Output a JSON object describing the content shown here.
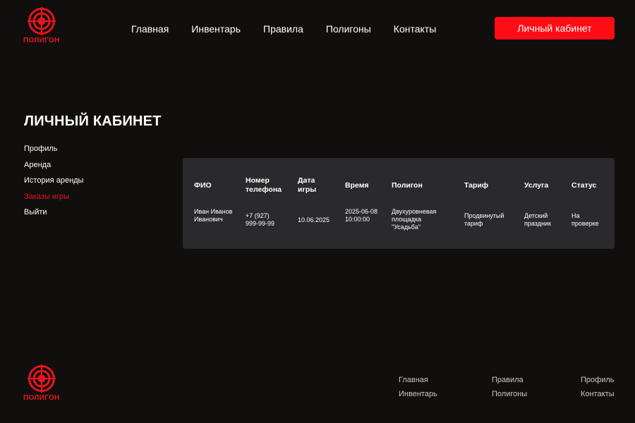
{
  "brand": {
    "name": "ПОЛИГОН",
    "accent": "#e8141b",
    "button_color": "#ff0c14"
  },
  "header": {
    "nav": [
      "Главная",
      "Инвентарь",
      "Правила",
      "Полигоны",
      "Контакты"
    ],
    "cabinet_button": "Личный кабинет"
  },
  "main": {
    "title": "ЛИЧНЫЙ КАБИНЕТ",
    "menu": [
      "Профиль",
      "Аренда",
      "История аренды",
      "Заказы игры",
      "Выйти"
    ],
    "active_menu": "Заказы игры",
    "table": {
      "headers": {
        "fio": "ФИО",
        "phone": "Номер телефона",
        "date": "Дата игры",
        "time": "Время",
        "polygon": "Полигон",
        "tariff": "Тариф",
        "service": "Услуга",
        "status": "Статус"
      },
      "rows": [
        {
          "fio": "Иван Иванов Иванович",
          "phone": "+7 (927) 999-99-99",
          "date": "10.06.2025",
          "time": "2025-06-08 10:00:00",
          "polygon": "Двухуровневая площадка \"Усадьба\"",
          "tariff": "Продвинутый тариф",
          "service": "Детский праздник",
          "status": "На проверке"
        }
      ]
    }
  },
  "footer": {
    "links": [
      "Главная",
      "Инвентарь",
      "Правила",
      "Полигоны",
      "Профиль",
      "Контакты"
    ]
  },
  "icons": {
    "logo": "target-icon"
  }
}
